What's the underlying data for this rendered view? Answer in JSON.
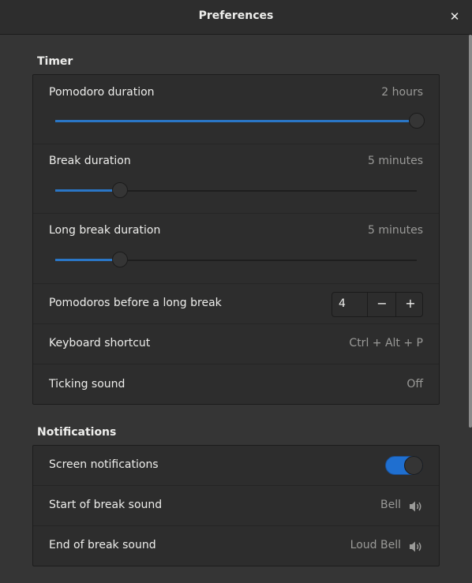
{
  "window": {
    "title": "Preferences",
    "close_glyph": "✕"
  },
  "timer": {
    "section_title": "Timer",
    "pomodoro": {
      "label": "Pomodoro duration",
      "value": "2 hours",
      "level": 1.0
    },
    "break": {
      "label": "Break duration",
      "value": "5 minutes",
      "level": 0.18
    },
    "long_break": {
      "label": "Long break duration",
      "value": "5 minutes",
      "level": 0.18
    },
    "pomodoros_before_long_break": {
      "label": "Pomodoros before a long break",
      "value": "4",
      "minus": "−",
      "plus": "+"
    },
    "shortcut": {
      "label": "Keyboard shortcut",
      "value": "Ctrl + Alt + P"
    },
    "ticking": {
      "label": "Ticking sound",
      "value": "Off"
    }
  },
  "notifications": {
    "section_title": "Notifications",
    "screen": {
      "label": "Screen notifications",
      "enabled": true
    },
    "start_break": {
      "label": "Start of break sound",
      "value": "Bell",
      "icon": "speaker-icon"
    },
    "end_break": {
      "label": "End of break sound",
      "value": "Loud Bell",
      "icon": "speaker-icon"
    }
  },
  "colors": {
    "accent": "#2a76c6",
    "background": "#353535",
    "list_background": "#2d2d2d"
  }
}
